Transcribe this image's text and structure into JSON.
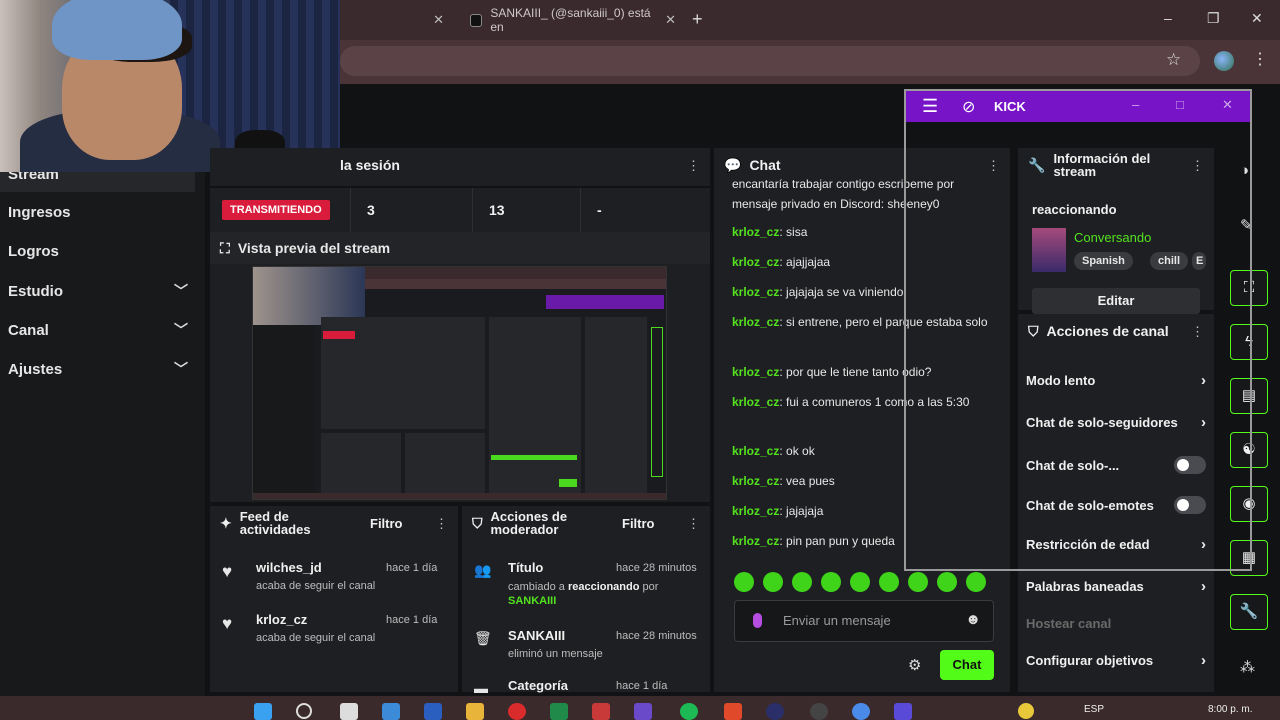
{
  "browser": {
    "tab1_close": "✕",
    "tab2_title": "SANKAIII_ (@sankaiii_0) está en",
    "tab2_close": "✕",
    "new_tab": "+",
    "window_controls": [
      "–",
      "❐",
      "✕"
    ],
    "icons": [
      "star-icon",
      "profile-globe-icon",
      "more-icon"
    ]
  },
  "sidebar": {
    "items": [
      {
        "label": "Stream",
        "expandable": false
      },
      {
        "label": "Ingresos",
        "expandable": false
      },
      {
        "label": "Logros",
        "expandable": false
      },
      {
        "label": "Estudio",
        "expandable": true
      },
      {
        "label": "Canal",
        "expandable": true
      },
      {
        "label": "Ajustes",
        "expandable": true
      }
    ],
    "chevron": "⌄"
  },
  "session": {
    "title": "la sesión",
    "live_badge": "TRANSMITIENDO",
    "stats": [
      "3",
      "13",
      "-"
    ]
  },
  "preview": {
    "title": "Vista previa del stream"
  },
  "feed": {
    "title": "Feed de actividades",
    "filter": "Filtro",
    "items": [
      {
        "name": "wilches_jd",
        "sub": "acaba de seguir el canal",
        "time": "hace 1 día"
      },
      {
        "name": "krloz_cz",
        "sub": "acaba de seguir el canal",
        "time": "hace 1 día"
      }
    ]
  },
  "mod_actions": {
    "title": "Acciones de moderador",
    "filter": "Filtro",
    "items": [
      {
        "name": "Título",
        "time": "hace 28 minutos",
        "sub_prefix": "cambiado a ",
        "sub_value": "reaccionando",
        "sub_mid": " por ",
        "sub_user": "SANKAIII"
      },
      {
        "name": "SANKAIII",
        "time": "hace 28 minutos",
        "sub": "eliminó un mensaje"
      },
      {
        "name": "Categoría",
        "time": "hace 1 día"
      }
    ]
  },
  "chat": {
    "title": "Chat",
    "messages": [
      {
        "user": "",
        "text": "encantaría trabajar contigo escribeme por mensaje privado en Discord: sheeney0"
      },
      {
        "user": "krloz_cz",
        "text": "sisa"
      },
      {
        "user": "krloz_cz",
        "text": "ajajjajaa"
      },
      {
        "user": "krloz_cz",
        "text": "jajajaja se va viniendo"
      },
      {
        "user": "krloz_cz",
        "text": "si entrene, pero el parque estaba solo"
      },
      {
        "user": "krloz_cz",
        "text": "por que le tiene tanto odio?"
      },
      {
        "user": "krloz_cz",
        "text": "fui a comuneros 1 como a las 5:30"
      },
      {
        "user": "krloz_cz",
        "text": "ok ok"
      },
      {
        "user": "krloz_cz",
        "text": "vea pues"
      },
      {
        "user": "krloz_cz",
        "text": "jajajaja"
      },
      {
        "user": "krloz_cz",
        "text": "pin pan pun y queda"
      }
    ],
    "input_placeholder": "Enviar un mensaje",
    "send_label": "Chat"
  },
  "stream_info": {
    "title": "Información del stream",
    "stream_title": "reaccionando",
    "category": "Conversando",
    "tags": [
      "Spanish",
      "chill",
      "E"
    ],
    "edit_label": "Editar"
  },
  "channel_actions": {
    "title": "Acciones de canal",
    "items": [
      {
        "label": "Modo lento",
        "control": "arrow"
      },
      {
        "label": "Chat de solo-seguidores",
        "control": "arrow"
      },
      {
        "label": "Chat de solo-...",
        "control": "toggle"
      },
      {
        "label": "Chat de solo-emotes",
        "control": "toggle"
      },
      {
        "label": "Restricción de edad",
        "control": "arrow"
      },
      {
        "label": "Palabras baneadas",
        "control": "arrow"
      },
      {
        "label": "Hostear canal",
        "control": "none"
      },
      {
        "label": "Configurar objetivos",
        "control": "arrow"
      }
    ]
  },
  "kick_window": {
    "title": "KICK",
    "controls": [
      "–",
      "□",
      "✕"
    ]
  },
  "taskbar": {
    "lang": "ESP",
    "clock": "8:00 p. m."
  },
  "colors": {
    "accent_green": "#53fc18",
    "live_red": "#d91c3c",
    "kick_purple": "#7814c8",
    "username_green": "#53e21f"
  }
}
